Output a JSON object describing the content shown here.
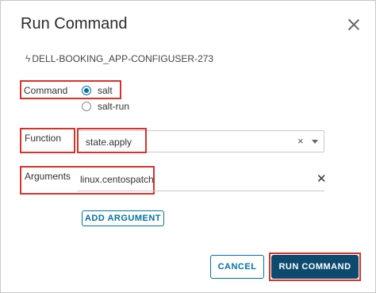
{
  "dialog": {
    "title": "Run Command",
    "target_name": "DELL-BOOKING_APP-CONFIGUSER-273"
  },
  "command": {
    "label": "Command",
    "options": [
      {
        "label": "salt",
        "selected": true
      },
      {
        "label": "salt-run",
        "selected": false
      }
    ]
  },
  "function": {
    "label": "Function",
    "value": "state.apply",
    "clear_glyph": "×"
  },
  "arguments": {
    "label": "Arguments",
    "value": "linux.centospatch",
    "clear_glyph": "✕"
  },
  "buttons": {
    "add_argument": "ADD ARGUMENT",
    "cancel": "CANCEL",
    "run_command": "RUN COMMAND"
  },
  "icons": {
    "target": "lightning-bolt-icon",
    "close": "close-icon"
  },
  "colors": {
    "accent": "#0072a3",
    "primary_button": "#0c4a6e",
    "highlight": "#d8322b"
  }
}
